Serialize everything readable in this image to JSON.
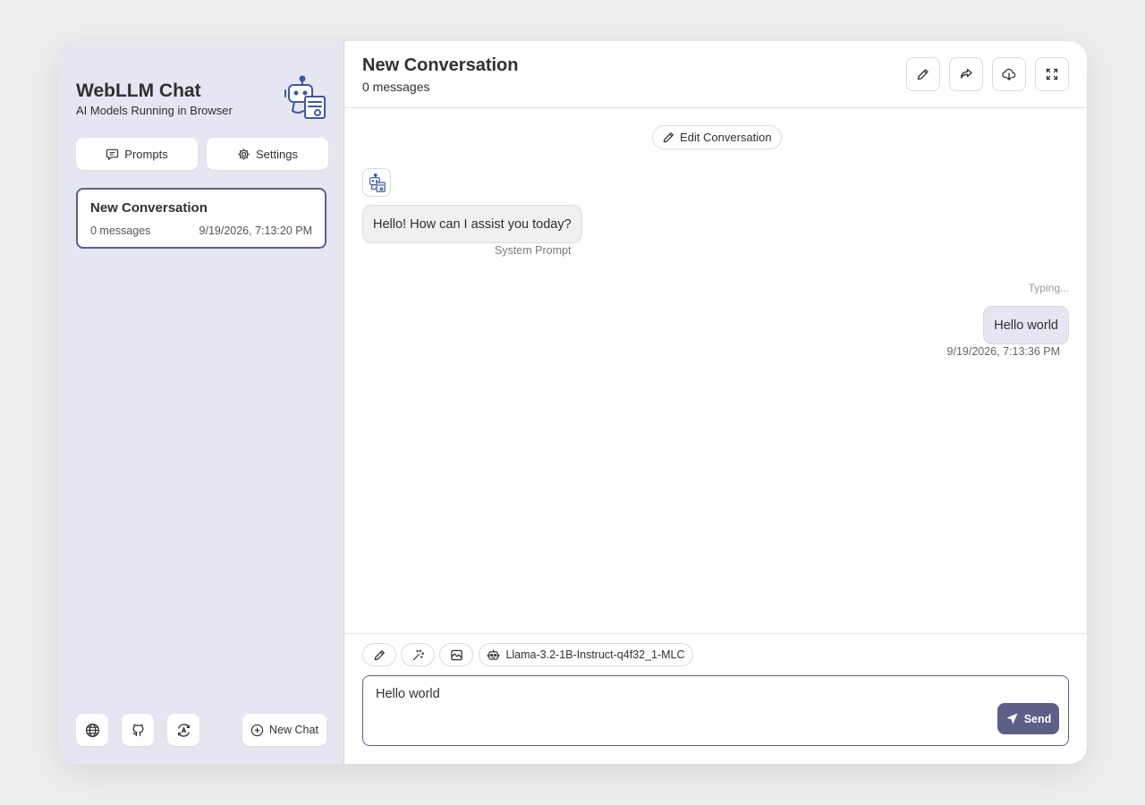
{
  "sidebar": {
    "app_title": "WebLLM Chat",
    "app_subtitle": "AI Models Running in Browser",
    "prompts_label": "Prompts",
    "settings_label": "Settings",
    "conversations": [
      {
        "title": "New Conversation",
        "count": "0 messages",
        "date": "9/19/2026, 7:13:20 PM"
      }
    ],
    "new_chat_label": "New Chat",
    "footer_icons": [
      "globe-icon",
      "github-icon",
      "theme-icon"
    ]
  },
  "header": {
    "title": "New Conversation",
    "subtitle": "0 messages",
    "actions": [
      "edit-icon",
      "share-icon",
      "download-icon",
      "fullscreen-icon"
    ]
  },
  "chat": {
    "edit_conversation_label": "Edit Conversation",
    "bot_message": "Hello! How can I assist you today?",
    "bot_meta": "System Prompt",
    "typing_label": "Typing...",
    "user_message": "Hello world",
    "user_meta": "9/19/2026, 7:13:36 PM"
  },
  "composer": {
    "model_label": "Llama-3.2-1B-Instruct-q4f32_1-MLC",
    "input_value": "Hello world",
    "send_label": "Send",
    "tool_icons": [
      "pencil-icon",
      "magic-wand-icon",
      "image-icon",
      "robot-icon"
    ]
  },
  "colors": {
    "accent": "#5c5f88",
    "sidebar_bg": "#e6e6f2",
    "logo_blue": "#3d5a9e"
  }
}
